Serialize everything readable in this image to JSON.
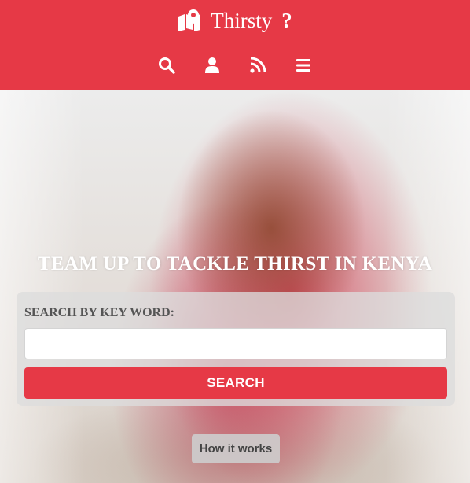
{
  "header": {
    "brand_name": "Thirsty",
    "brand_mark": "?",
    "brand_icon": "map-marker-icon",
    "accent_color": "#e63946"
  },
  "nav": {
    "items": [
      {
        "icon": "search-icon"
      },
      {
        "icon": "user-icon"
      },
      {
        "icon": "rss-icon"
      },
      {
        "icon": "menu-icon"
      }
    ]
  },
  "hero": {
    "tagline": "TEAM UP TO TACKLE THIRST IN KENYA"
  },
  "search": {
    "label": "SEARCH BY KEY WORD:",
    "value": "",
    "placeholder": "",
    "button_label": "SEARCH"
  },
  "how_it_works": {
    "label": "How it works"
  }
}
